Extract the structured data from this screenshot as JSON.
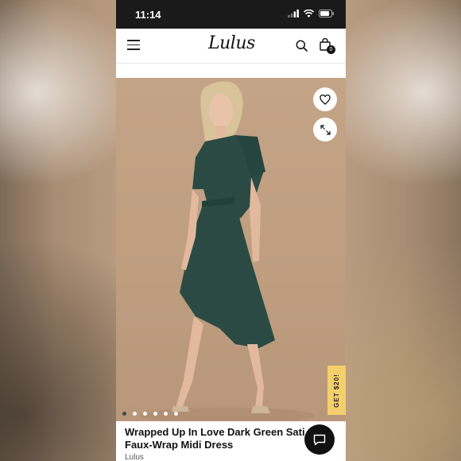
{
  "status_bar": {
    "time": "11:14"
  },
  "header": {
    "menu_icon": "hamburger-icon",
    "logo": "Lulus",
    "search_icon": "search-icon",
    "bag_icon": "shopping-bag-icon",
    "bag_count": "0"
  },
  "gallery": {
    "favorite_icon": "heart-icon",
    "expand_icon": "expand-icon",
    "dot_count": 6,
    "active_dot": 0,
    "promo_label": "GET $20!"
  },
  "product": {
    "title_line1": "Wrapped Up In Love Dark Green Sati",
    "title_line2": "Faux-Wrap Midi Dress",
    "brand": "Lulus"
  },
  "chat": {
    "icon": "chat-icon"
  },
  "colors": {
    "dress": "#2b4a44",
    "backdrop": "#c4a486",
    "promo": "#f4cf6b"
  }
}
